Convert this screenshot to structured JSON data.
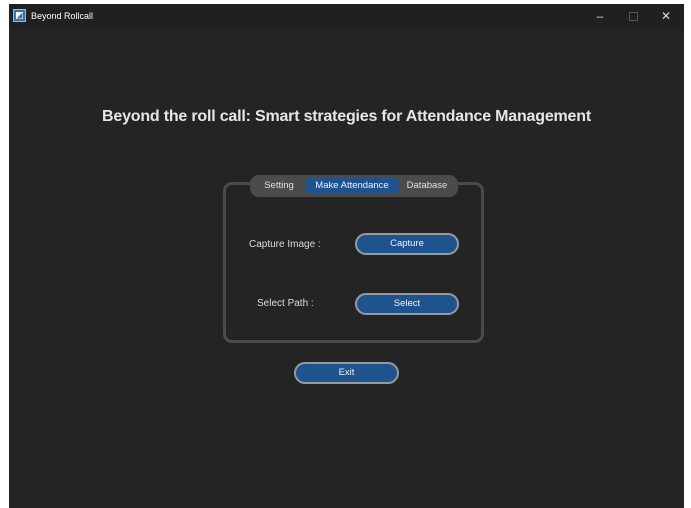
{
  "window": {
    "title": "Beyond Rollcall",
    "icon": "app-logo-icon",
    "controls": {
      "minimize": "–",
      "close": "✕"
    }
  },
  "heading": "Beyond the roll call: Smart strategies for Attendance Management",
  "tabs": [
    {
      "label": "Setting",
      "selected": false
    },
    {
      "label": "Make Attendance",
      "selected": true
    },
    {
      "label": "Database",
      "selected": false
    }
  ],
  "form": {
    "capture_label": "Capture Image :",
    "capture_button": "Capture",
    "path_label": "Select Path :",
    "select_button": "Select"
  },
  "exit_button": "Exit",
  "colors": {
    "background": "#242424",
    "titlebar": "#202020",
    "accent": "#1f538d",
    "frame_border": "#4b4b4b",
    "button_border": "#949a9f"
  }
}
